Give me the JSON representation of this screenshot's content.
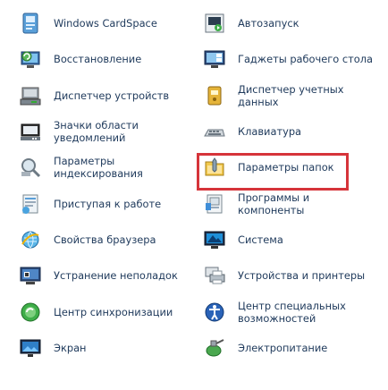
{
  "left_column": [
    {
      "label": "Windows CardSpace",
      "icon": "cardspace-icon"
    },
    {
      "label": "Восстановление",
      "icon": "recovery-icon"
    },
    {
      "label": "Диспетчер устройств",
      "icon": "device-manager-icon"
    },
    {
      "label": "Значки области\nуведомлений",
      "icon": "notification-area-icon"
    },
    {
      "label": "Параметры\nиндексирования",
      "icon": "indexing-icon"
    },
    {
      "label": "Приступая к работе",
      "icon": "getting-started-icon"
    },
    {
      "label": "Свойства браузера",
      "icon": "internet-options-icon"
    },
    {
      "label": "Устранение неполадок",
      "icon": "troubleshooting-icon"
    },
    {
      "label": "Центр синхронизации",
      "icon": "sync-center-icon"
    },
    {
      "label": "Экран",
      "icon": "display-icon"
    }
  ],
  "right_column": [
    {
      "label": "Автозапуск",
      "icon": "autoplay-icon"
    },
    {
      "label": "Гаджеты рабочего стола",
      "icon": "gadgets-icon"
    },
    {
      "label": "Диспетчер учетных\nданных",
      "icon": "credential-manager-icon"
    },
    {
      "label": "Клавиатура",
      "icon": "keyboard-icon"
    },
    {
      "label": "Параметры папок",
      "icon": "folder-options-icon"
    },
    {
      "label": "Программы и\nкомпоненты",
      "icon": "programs-features-icon"
    },
    {
      "label": "Система",
      "icon": "system-icon"
    },
    {
      "label": "Устройства и принтеры",
      "icon": "devices-printers-icon"
    },
    {
      "label": "Центр специальных\nвозможностей",
      "icon": "ease-of-access-icon"
    },
    {
      "label": "Электропитание",
      "icon": "power-options-icon"
    }
  ],
  "highlighted_item": "Параметры папок",
  "colors": {
    "label": "#1e395b",
    "highlight_border": "#d6343a"
  }
}
